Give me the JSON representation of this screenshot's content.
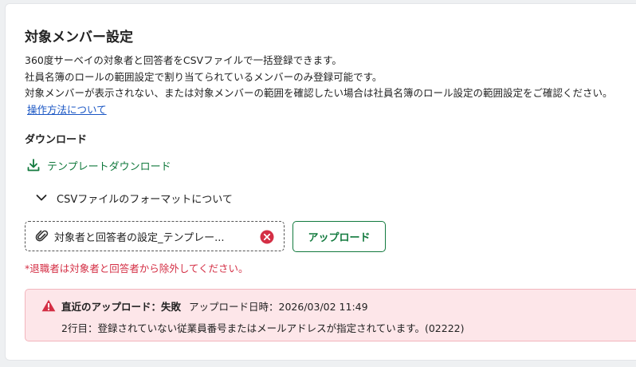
{
  "section": {
    "title": "対象メンバー設定",
    "desc_lines": [
      "360度サーベイの対象者と回答者をCSVファイルで一括登録できます。",
      "社員名簿のロールの範囲設定で割り当てられているメンバーのみ登録可能です。",
      "対象メンバーが表示されない、または対象メンバーの範囲を確認したい場合は社員名簿のロール設定の範囲設定をご確認ください。"
    ],
    "help_link": "操作方法について"
  },
  "download": {
    "heading": "ダウンロード",
    "template_link": "テンプレートダウンロード",
    "format_toggle": "CSVファイルのフォーマットについて"
  },
  "upload": {
    "file_name": "対象者と回答者の設定_テンプレー...",
    "button_label": "アップロード",
    "note": "*退職者は対象者と回答者から除外してください。"
  },
  "alert": {
    "title": "直近のアップロード：失敗",
    "timestamp": "アップロード日時：2026/03/02 11:49",
    "message": "2行目：登録されていない従業員番号またはメールアドレスが指定されています。(02222)"
  },
  "colors": {
    "accent_green": "#127a3e",
    "link_blue": "#1a56c4",
    "error_red": "#d42f45",
    "alert_bg": "#fde6e9"
  },
  "icons": {
    "download": "download-icon",
    "chevron": "chevron-down-icon",
    "attachment": "paperclip-icon",
    "remove": "close-circle-icon",
    "warning": "warning-icon"
  }
}
